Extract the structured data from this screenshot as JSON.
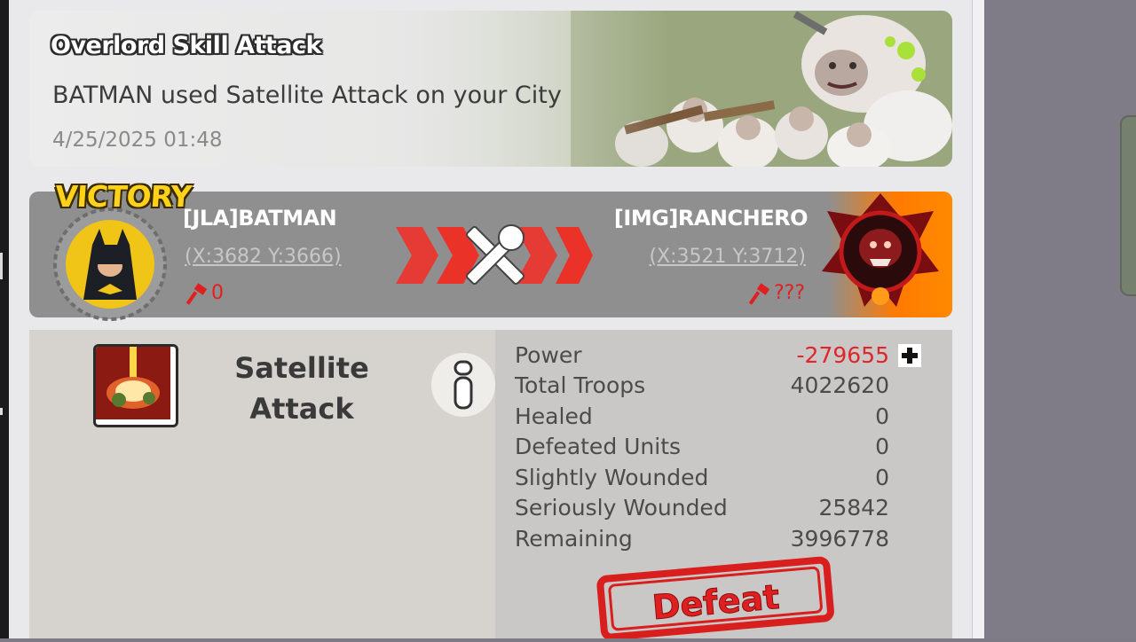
{
  "notification": {
    "title": "Overlord Skill Attack",
    "description": "BATMAN used Satellite Attack on your City",
    "timestamp": "4/25/2025 01:48"
  },
  "battle": {
    "result_label": "VICTORY",
    "attacker": {
      "name": "[JLA]BATMAN",
      "coords": "(X:3682 Y:3666)",
      "kills": "0"
    },
    "defender": {
      "name": "[IMG]RANCHERO",
      "coords": "(X:3521 Y:3712)",
      "kills": "???"
    }
  },
  "skill": {
    "name_line1": "Satellite",
    "name_line2": "Attack"
  },
  "stats": [
    {
      "label": "Power",
      "value": "-279655"
    },
    {
      "label": "Total Troops",
      "value": "4022620"
    },
    {
      "label": "Healed",
      "value": "0"
    },
    {
      "label": "Defeated Units",
      "value": "0"
    },
    {
      "label": "Slightly Wounded",
      "value": "0"
    },
    {
      "label": "Seriously Wounded",
      "value": "25842"
    },
    {
      "label": "Remaining",
      "value": "3996778"
    }
  ],
  "result_stamp": "Defeat",
  "colors": {
    "negative": "#e0262b",
    "accent_orange": "#ff7a00",
    "stamp_red": "#d91e1e"
  },
  "icons": [
    "battle-swords-icon",
    "kill-hammer-icon",
    "info-icon",
    "plus-icon",
    "satellite-skill-icon"
  ]
}
